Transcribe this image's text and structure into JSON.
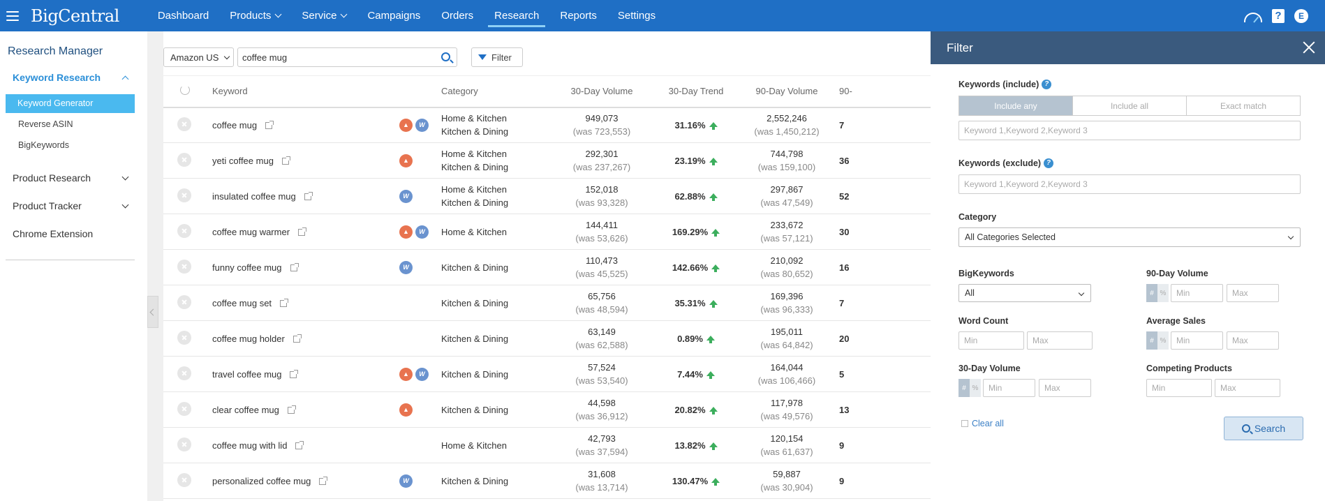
{
  "app": {
    "logo": "BigCentral"
  },
  "nav": {
    "items": [
      {
        "label": "Dashboard"
      },
      {
        "label": "Products"
      },
      {
        "label": "Service"
      },
      {
        "label": "Campaigns"
      },
      {
        "label": "Orders"
      },
      {
        "label": "Research"
      },
      {
        "label": "Reports"
      },
      {
        "label": "Settings"
      }
    ],
    "active": "Research",
    "avatar": "E"
  },
  "sidebar": {
    "title": "Research Manager",
    "keyword_research": "Keyword Research",
    "keyword_generator": "Keyword Generator",
    "reverse_asin": "Reverse ASIN",
    "bigkeywords": "BigKeywords",
    "product_research": "Product Research",
    "product_tracker": "Product Tracker",
    "chrome_extension": "Chrome Extension"
  },
  "toolbar": {
    "marketplace": "Amazon US",
    "search_value": "coffee mug",
    "filter_label": "Filter"
  },
  "table": {
    "headers": {
      "keyword": "Keyword",
      "category": "Category",
      "vol30": "30-Day Volume",
      "trend30": "30-Day Trend",
      "vol90": "90-Day Volume",
      "extra": "90-"
    },
    "rows": [
      {
        "keyword": "coffee mug",
        "hot": true,
        "big": true,
        "cat1": "Home & Kitchen",
        "cat2": "Kitchen & Dining",
        "vol30": "949,073",
        "was30": "(was 723,553)",
        "trend": "31.16%",
        "vol90": "2,552,246",
        "was90": "(was 1,450,212)",
        "extra": "7"
      },
      {
        "keyword": "yeti coffee mug",
        "hot": true,
        "big": false,
        "cat1": "Home & Kitchen",
        "cat2": "Kitchen & Dining",
        "vol30": "292,301",
        "was30": "(was 237,267)",
        "trend": "23.19%",
        "vol90": "744,798",
        "was90": "(was 159,100)",
        "extra": "36"
      },
      {
        "keyword": "insulated coffee mug",
        "hot": false,
        "big": true,
        "cat1": "Home & Kitchen",
        "cat2": "Kitchen & Dining",
        "vol30": "152,018",
        "was30": "(was 93,328)",
        "trend": "62.88%",
        "vol90": "297,867",
        "was90": "(was 47,549)",
        "extra": "52"
      },
      {
        "keyword": "coffee mug warmer",
        "hot": true,
        "big": true,
        "cat1": "Home & Kitchen",
        "cat2": "",
        "vol30": "144,411",
        "was30": "(was 53,626)",
        "trend": "169.29%",
        "vol90": "233,672",
        "was90": "(was 57,121)",
        "extra": "30"
      },
      {
        "keyword": "funny coffee mug",
        "hot": false,
        "big": true,
        "cat1": "Kitchen & Dining",
        "cat2": "",
        "vol30": "110,473",
        "was30": "(was 45,525)",
        "trend": "142.66%",
        "vol90": "210,092",
        "was90": "(was 80,652)",
        "extra": "16"
      },
      {
        "keyword": "coffee mug set",
        "hot": false,
        "big": false,
        "cat1": "Kitchen & Dining",
        "cat2": "",
        "vol30": "65,756",
        "was30": "(was 48,594)",
        "trend": "35.31%",
        "vol90": "169,396",
        "was90": "(was 96,333)",
        "extra": "7"
      },
      {
        "keyword": "coffee mug holder",
        "hot": false,
        "big": false,
        "cat1": "Kitchen & Dining",
        "cat2": "",
        "vol30": "63,149",
        "was30": "(was 62,588)",
        "trend": "0.89%",
        "vol90": "195,011",
        "was90": "(was 64,842)",
        "extra": "20"
      },
      {
        "keyword": "travel coffee mug",
        "hot": true,
        "big": true,
        "cat1": "Kitchen & Dining",
        "cat2": "",
        "vol30": "57,524",
        "was30": "(was 53,540)",
        "trend": "7.44%",
        "vol90": "164,044",
        "was90": "(was 106,466)",
        "extra": "5"
      },
      {
        "keyword": "clear coffee mug",
        "hot": true,
        "big": false,
        "cat1": "Kitchen & Dining",
        "cat2": "",
        "vol30": "44,598",
        "was30": "(was 36,912)",
        "trend": "20.82%",
        "vol90": "117,978",
        "was90": "(was 49,576)",
        "extra": "13"
      },
      {
        "keyword": "coffee mug with lid",
        "hot": false,
        "big": false,
        "cat1": "Home & Kitchen",
        "cat2": "",
        "vol30": "42,793",
        "was30": "(was 37,594)",
        "trend": "13.82%",
        "vol90": "120,154",
        "was90": "(was 61,637)",
        "extra": "9"
      },
      {
        "keyword": "personalized coffee mug",
        "hot": false,
        "big": true,
        "cat1": "Kitchen & Dining",
        "cat2": "",
        "vol30": "31,608",
        "was30": "(was 13,714)",
        "trend": "130.47%",
        "vol90": "59,887",
        "was90": "(was 30,904)",
        "extra": "9"
      }
    ]
  },
  "filter": {
    "title": "Filter",
    "kw_include_label": "Keywords (include)",
    "include_any": "Include any",
    "include_all": "Include all",
    "exact_match": "Exact match",
    "kw_placeholder": "Keyword 1,Keyword 2,Keyword 3",
    "kw_exclude_label": "Keywords (exclude)",
    "category_label": "Category",
    "category_value": "All Categories Selected",
    "bigkeywords_label": "BigKeywords",
    "bigkeywords_value": "All",
    "vol90_label": "90-Day Volume",
    "word_count_label": "Word Count",
    "avg_sales_label": "Average Sales",
    "vol30_label": "30-Day Volume",
    "competing_label": "Competing Products",
    "min": "Min",
    "max": "Max",
    "hash": "#",
    "pct": "%",
    "help": "?",
    "clear_all": "Clear all",
    "search": "Search"
  },
  "colors": {
    "topbar": "#1f6fc5",
    "accent": "#4ab9ef",
    "trend_up": "#3cae5d",
    "panel_header": "#3a5a7e"
  }
}
